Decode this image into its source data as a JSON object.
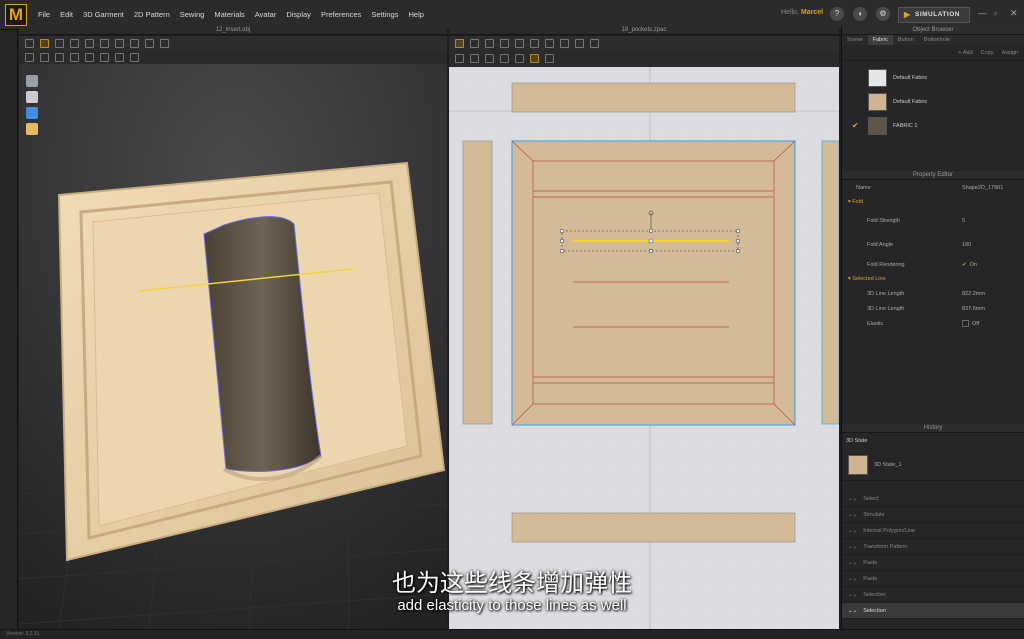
{
  "app": {
    "logo": "M",
    "menu": [
      "File",
      "Edit",
      "3D Garment",
      "2D Pattern",
      "Sewing",
      "Materials",
      "Avatar",
      "Display",
      "Preferences",
      "Settings",
      "Help"
    ],
    "greeting": "Hello,",
    "user": "Marcel",
    "mode_button": "SIMULATION",
    "accent_color": "#e0a21b"
  },
  "viewport3d": {
    "title": "12_insert.obj"
  },
  "viewport2d": {
    "title": "18_pockets.zpac"
  },
  "object_browser": {
    "title": "Object Browser",
    "tabs": [
      "Scene",
      "Fabric",
      "Button",
      "Buttonhole"
    ],
    "active_tab": "Fabric",
    "actions": [
      "+ Add",
      "Copy",
      "Assign"
    ],
    "fabrics": [
      {
        "name": "Default Fabric",
        "color": "#e6e6e6",
        "checked": false
      },
      {
        "name": "Default Fabric",
        "color": "#cfb492",
        "checked": false
      },
      {
        "name": "FABRIC 1",
        "color": "#5e5548",
        "checked": true
      }
    ]
  },
  "property_editor": {
    "title": "Property Editor",
    "name_label": "Name",
    "name_value": "Shape2D_17901",
    "fold_section": "Fold",
    "fold_strength_label": "Fold Strength",
    "fold_strength_value": "5",
    "fold_angle_label": "Fold Angle",
    "fold_angle_value": "180",
    "fold_rendering_label": "Fold Rendering",
    "fold_rendering_value": "On",
    "selected_line_section": "Selected Line",
    "line_length_3d_label": "3D Line Length",
    "line_length_3d_value": "822.2mm",
    "line_length_2d_label": "3D Line Length",
    "line_length_2d_value": "837.6mm",
    "elastic_label": "Elastic",
    "elastic_value": "Off"
  },
  "history": {
    "title": "History",
    "state_header": "3D State",
    "state_item": "3D State_1",
    "items": [
      {
        "label": "Select",
        "active": false
      },
      {
        "label": "Simulate",
        "active": false
      },
      {
        "label": "Internal Polygon/Line",
        "active": false
      },
      {
        "label": "Transform Pattern",
        "active": false
      },
      {
        "label": "Paste",
        "active": false
      },
      {
        "label": "Paste",
        "active": false
      },
      {
        "label": "Selection",
        "active": false
      },
      {
        "label": "Selection",
        "active": true
      }
    ]
  },
  "status": {
    "version": "Version: 3.2.31"
  },
  "subtitles": {
    "chinese": "也为这些线条增加弹性",
    "english": "add elasticity to those lines as well"
  }
}
